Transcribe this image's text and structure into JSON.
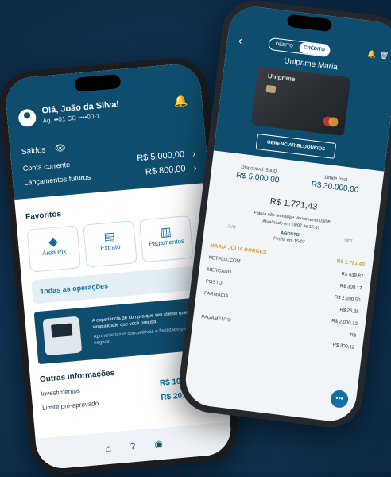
{
  "left": {
    "greeting": "Olá, João da Silva!",
    "account": "Ag. ••01  CC ••••00-1",
    "saldos_label": "Saldos",
    "conta_label": "Conta corrente",
    "conta_value": "R$ 5.000,00",
    "lanc_label": "Lançamentos futuros",
    "lanc_value": "R$ 800,00",
    "favoritos_title": "Favoritos",
    "fav_items": [
      "Área Pix",
      "Extrato",
      "Pagamentos"
    ],
    "todas_label": "Todas as operações",
    "banner_text": "A experiência de compra que seu cliente quer com a simplicidade que você precisa.",
    "banner_sub": "Aproveite taxas competitivas e facilidade para seu negócio.",
    "outras_title": "Outras informações",
    "invest_label": "Investimentos",
    "invest_value": "R$ 10.000,00",
    "limite_label": "Limite pré-aprovado",
    "limite_value": "R$ 20.000,00"
  },
  "right": {
    "toggle_debito": "DÉBITO",
    "toggle_credito": "CRÉDITO",
    "card_name": "Uniprime Maria",
    "card_brand": "Uniprime",
    "gerenciar": "GERENCIAR BLOQUEIOS",
    "limite_disp_label": "Disponível: 5000",
    "limite_disp_value": "R$ 5.000,00",
    "limite_total_label": "Limite total",
    "limite_total_value": "R$ 30.000,00",
    "fatura_amount": "R$ 1.721,43",
    "fatura_line": "Fatura não fechada • Vencimento 03/08",
    "fatura_updated": "Atualizado em 19/07 às 15:31",
    "month_prev": "JUN",
    "month_cur": "AGOSTO",
    "month_next": "SET",
    "fecha": "Fecha em 15/07",
    "holder": "MARIA JÚLIA BORGES",
    "holder_total": "R$ 1.721,43",
    "transactions": [
      {
        "label": "NETFLIX.COM",
        "value": "R$ 439,87"
      },
      {
        "label": "MERCADO",
        "value": "R$ 300,12"
      },
      {
        "label": "POSTO",
        "value": "R$ 2.200,50"
      },
      {
        "label": "FARMÁCIA",
        "value": "R$ 25,25"
      },
      {
        "label": "",
        "value": "R$ 2.000,12"
      },
      {
        "label": "PAGAMENTO",
        "value": "R$"
      },
      {
        "label": "",
        "value": "R$ 300,12"
      }
    ]
  }
}
